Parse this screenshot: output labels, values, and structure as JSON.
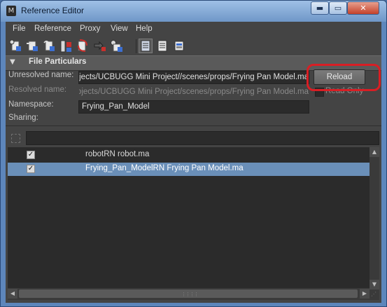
{
  "window": {
    "title": "Reference Editor",
    "min_glyph": "▬",
    "max_glyph": "▭",
    "close_glyph": "✕"
  },
  "menu": {
    "items": [
      "File",
      "Reference",
      "Proxy",
      "View",
      "Help"
    ]
  },
  "toolbar": {
    "buttons": [
      {
        "icon": "load-reference-icon"
      },
      {
        "icon": "unload-reference-icon"
      },
      {
        "icon": "reload-reference-icon"
      },
      {
        "icon": "import-objects-icon"
      },
      {
        "icon": "remove-reference-icon"
      },
      {
        "icon": "replace-reference-icon"
      },
      {
        "icon": "select-file-icon"
      },
      {
        "icon": "reference-list-active-icon",
        "active": true
      },
      {
        "icon": "list-view-icon"
      },
      {
        "icon": "proxy-view-icon"
      }
    ]
  },
  "file_particulars": {
    "section_title": "File Particulars",
    "unresolved_label": "Unresolved name:",
    "unresolved_value": "/projects/UCBUGG Mini Project//scenes/props/Frying Pan Model.ma",
    "resolved_label": "Resolved name:",
    "resolved_value": "/projects/UCBUGG Mini Project/scenes/props/Frying Pan Model.ma",
    "namespace_label": "Namespace:",
    "namespace_value": "Frying_Pan_Model",
    "sharing_label": "Sharing:",
    "reload_label": "Reload",
    "read_only_label": "Read Only"
  },
  "references": [
    {
      "checked": true,
      "text": "robotRN robot.ma",
      "selected": false
    },
    {
      "checked": true,
      "text": "Frying_Pan_ModelRN Frying Pan Model.ma",
      "selected": true
    }
  ],
  "colors": {
    "highlight": "#d91e24",
    "selection": "#6a8fb8",
    "panel": "#444444"
  }
}
